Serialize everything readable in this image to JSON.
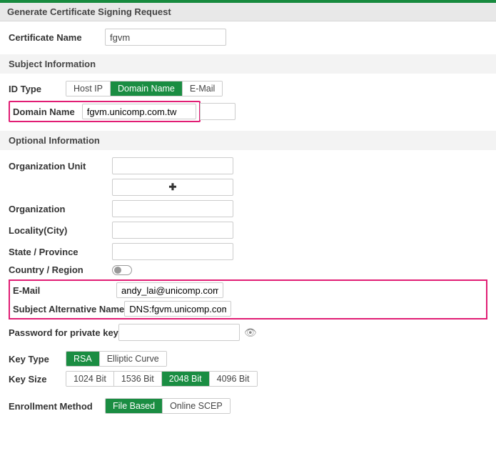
{
  "header": {
    "title": "Generate Certificate Signing Request"
  },
  "certName": {
    "label": "Certificate Name",
    "value": "fgvm"
  },
  "sections": {
    "subject": "Subject Information",
    "optional": "Optional Information"
  },
  "idType": {
    "label": "ID Type",
    "options": [
      "Host IP",
      "Domain Name",
      "E-Mail"
    ],
    "selected": "Domain Name"
  },
  "domainName": {
    "label": "Domain Name",
    "value": "fgvm.unicomp.com.tw"
  },
  "orgUnit": {
    "label": "Organization Unit",
    "value": ""
  },
  "organization": {
    "label": "Organization",
    "value": ""
  },
  "locality": {
    "label": "Locality(City)",
    "value": ""
  },
  "state": {
    "label": "State / Province",
    "value": ""
  },
  "country": {
    "label": "Country / Region",
    "enabled": false
  },
  "email": {
    "label": "E-Mail",
    "value": "andy_lai@unicomp.com.tw"
  },
  "san": {
    "label": "Subject Alternative Name",
    "value": "DNS:fgvm.unicomp.com.tw"
  },
  "pw": {
    "label": "Password for private key",
    "value": ""
  },
  "keyType": {
    "label": "Key Type",
    "options": [
      "RSA",
      "Elliptic Curve"
    ],
    "selected": "RSA"
  },
  "keySize": {
    "label": "Key Size",
    "options": [
      "1024 Bit",
      "1536 Bit",
      "2048 Bit",
      "4096 Bit"
    ],
    "selected": "2048 Bit"
  },
  "enroll": {
    "label": "Enrollment Method",
    "options": [
      "File Based",
      "Online SCEP"
    ],
    "selected": "File Based"
  }
}
